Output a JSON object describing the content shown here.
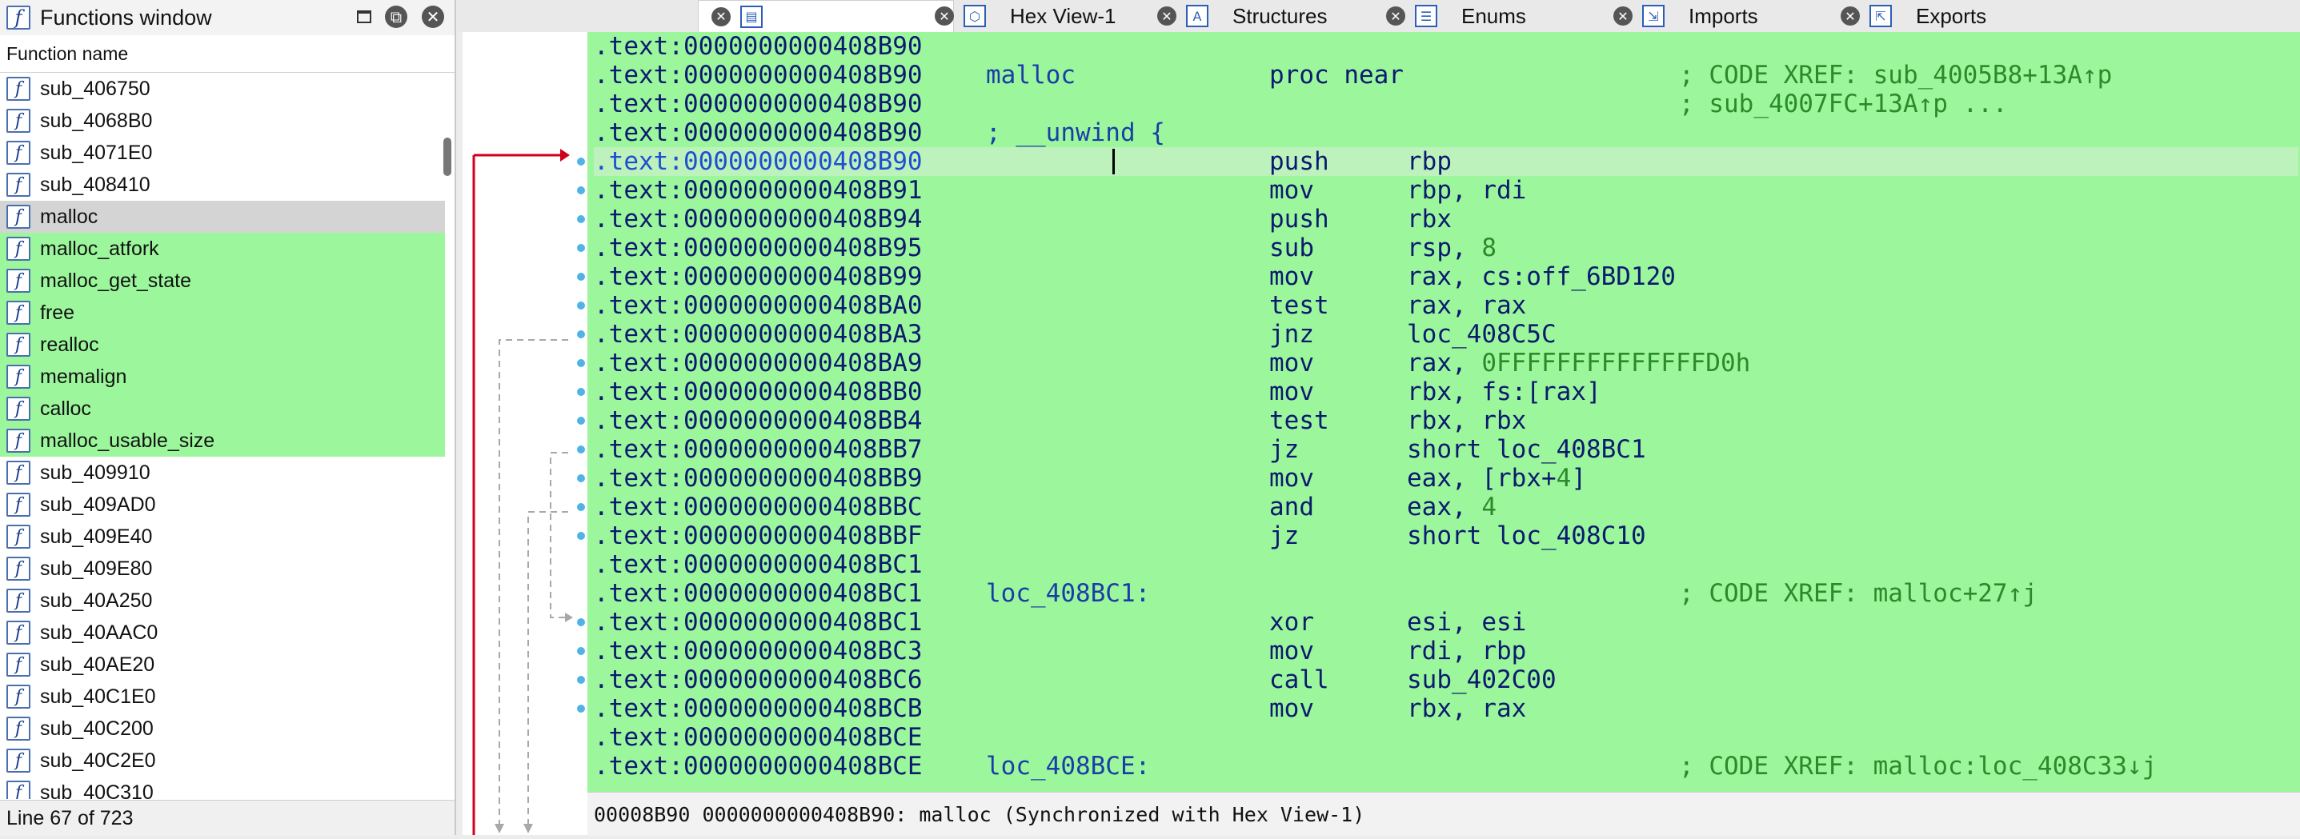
{
  "functions_window": {
    "title": "Functions window",
    "column_header": "Function name",
    "items": [
      {
        "name": "sub_406750",
        "state": "normal"
      },
      {
        "name": "sub_4068B0",
        "state": "normal"
      },
      {
        "name": "sub_4071E0",
        "state": "normal"
      },
      {
        "name": "sub_408410",
        "state": "normal"
      },
      {
        "name": "malloc",
        "state": "selected"
      },
      {
        "name": "malloc_atfork",
        "state": "green"
      },
      {
        "name": "malloc_get_state",
        "state": "green"
      },
      {
        "name": "free",
        "state": "green"
      },
      {
        "name": "realloc",
        "state": "green"
      },
      {
        "name": "memalign",
        "state": "green"
      },
      {
        "name": "calloc",
        "state": "green"
      },
      {
        "name": "malloc_usable_size",
        "state": "green"
      },
      {
        "name": "sub_409910",
        "state": "normal"
      },
      {
        "name": "sub_409AD0",
        "state": "normal"
      },
      {
        "name": "sub_409E40",
        "state": "normal"
      },
      {
        "name": "sub_409E80",
        "state": "normal"
      },
      {
        "name": "sub_40A250",
        "state": "normal"
      },
      {
        "name": "sub_40AAC0",
        "state": "normal"
      },
      {
        "name": "sub_40AE20",
        "state": "normal"
      },
      {
        "name": "sub_40C1E0",
        "state": "normal"
      },
      {
        "name": "sub_40C200",
        "state": "normal"
      },
      {
        "name": "sub_40C2E0",
        "state": "normal"
      },
      {
        "name": "sub_40C310",
        "state": "normal"
      }
    ],
    "status": "Line 67 of 723"
  },
  "tabs": [
    {
      "label": "",
      "icon": "disassembly-icon",
      "active": true
    },
    {
      "label": "Hex View-1",
      "icon": "hex-view-icon",
      "active": false
    },
    {
      "label": "Structures",
      "icon": "structures-icon",
      "active": false
    },
    {
      "label": "Enums",
      "icon": "enums-icon",
      "active": false
    },
    {
      "label": "Imports",
      "icon": "imports-icon",
      "active": false
    },
    {
      "label": "Exports",
      "icon": "exports-icon",
      "active": false
    }
  ],
  "disasm": {
    "lines": [
      {
        "addr": ".text:0000000000408B90",
        "name": "",
        "mnem": "",
        "ops": "",
        "comment": ""
      },
      {
        "addr": ".text:0000000000408B90",
        "name": "malloc",
        "mnem": "proc near",
        "ops": "",
        "comment": "; CODE XREF: sub_4005B8+13A↑p"
      },
      {
        "addr": ".text:0000000000408B90",
        "name": "",
        "mnem": "",
        "ops": "",
        "comment": "; sub_4007FC+13A↑p ..."
      },
      {
        "addr": ".text:0000000000408B90",
        "name": "; __unwind {",
        "mnem": "",
        "ops": "",
        "comment": ""
      },
      {
        "addr": ".text:0000000000408B90",
        "name": "",
        "mnem": "push",
        "ops": "rbp",
        "comment": "",
        "current": true
      },
      {
        "addr": ".text:0000000000408B91",
        "name": "",
        "mnem": "mov",
        "ops": "rbp, rdi",
        "comment": ""
      },
      {
        "addr": ".text:0000000000408B94",
        "name": "",
        "mnem": "push",
        "ops": "rbx",
        "comment": ""
      },
      {
        "addr": ".text:0000000000408B95",
        "name": "",
        "mnem": "sub",
        "ops": "rsp, 8",
        "comment": ""
      },
      {
        "addr": ".text:0000000000408B99",
        "name": "",
        "mnem": "mov",
        "ops": "rax, cs:off_6BD120",
        "comment": ""
      },
      {
        "addr": ".text:0000000000408BA0",
        "name": "",
        "mnem": "test",
        "ops": "rax, rax",
        "comment": ""
      },
      {
        "addr": ".text:0000000000408BA3",
        "name": "",
        "mnem": "jnz",
        "ops": "loc_408C5C",
        "comment": ""
      },
      {
        "addr": ".text:0000000000408BA9",
        "name": "",
        "mnem": "mov",
        "ops": "rax, 0FFFFFFFFFFFFFFD0h",
        "comment": ""
      },
      {
        "addr": ".text:0000000000408BB0",
        "name": "",
        "mnem": "mov",
        "ops": "rbx, fs:[rax]",
        "comment": ""
      },
      {
        "addr": ".text:0000000000408BB4",
        "name": "",
        "mnem": "test",
        "ops": "rbx, rbx",
        "comment": ""
      },
      {
        "addr": ".text:0000000000408BB7",
        "name": "",
        "mnem": "jz",
        "ops": "short loc_408BC1",
        "comment": ""
      },
      {
        "addr": ".text:0000000000408BB9",
        "name": "",
        "mnem": "mov",
        "ops": "eax, [rbx+4]",
        "comment": ""
      },
      {
        "addr": ".text:0000000000408BBC",
        "name": "",
        "mnem": "and",
        "ops": "eax, 4",
        "comment": ""
      },
      {
        "addr": ".text:0000000000408BBF",
        "name": "",
        "mnem": "jz",
        "ops": "short loc_408C10",
        "comment": ""
      },
      {
        "addr": ".text:0000000000408BC1",
        "name": "",
        "mnem": "",
        "ops": "",
        "comment": ""
      },
      {
        "addr": ".text:0000000000408BC1",
        "name": "loc_408BC1:",
        "mnem": "",
        "ops": "",
        "comment": "; CODE XREF: malloc+27↑j"
      },
      {
        "addr": ".text:0000000000408BC1",
        "name": "",
        "mnem": "xor",
        "ops": "esi, esi",
        "comment": ""
      },
      {
        "addr": ".text:0000000000408BC3",
        "name": "",
        "mnem": "mov",
        "ops": "rdi, rbp",
        "comment": ""
      },
      {
        "addr": ".text:0000000000408BC6",
        "name": "",
        "mnem": "call",
        "ops": "sub_402C00",
        "comment": ""
      },
      {
        "addr": ".text:0000000000408BCB",
        "name": "",
        "mnem": "mov",
        "ops": "rbx, rax",
        "comment": ""
      },
      {
        "addr": ".text:0000000000408BCE",
        "name": "",
        "mnem": "",
        "ops": "",
        "comment": ""
      },
      {
        "addr": ".text:0000000000408BCE",
        "name": "loc_408BCE:",
        "mnem": "",
        "ops": "",
        "comment": "; CODE XREF: malloc:loc_408C33↓j"
      }
    ],
    "status": "00008B90 0000000000408B90: malloc (Synchronized with Hex View-1)"
  },
  "colors": {
    "highlight_green": "#9cf79c",
    "selected_gray": "#d4d4d4",
    "jump_arrow_red": "#d0021b"
  }
}
